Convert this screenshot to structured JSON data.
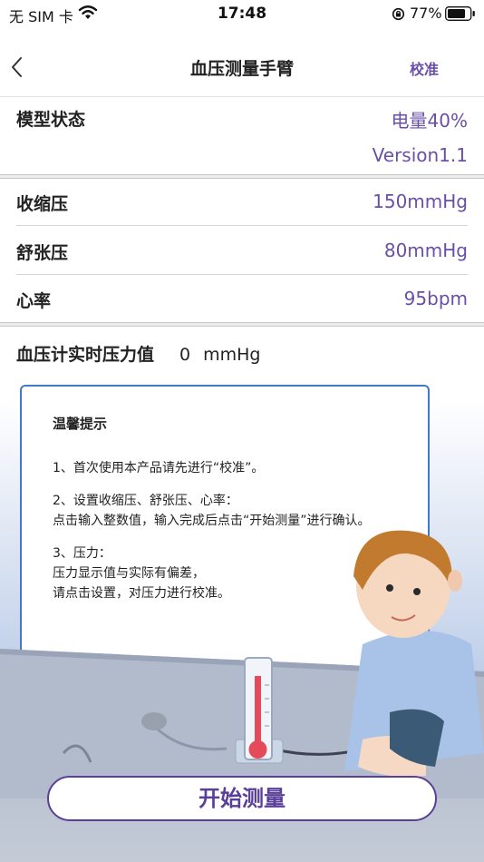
{
  "status_bar": {
    "carrier": "无 SIM 卡",
    "time": "17:48",
    "battery": "77%"
  },
  "nav": {
    "title": "血压测量手臂",
    "action": "校准"
  },
  "model": {
    "label": "模型状态",
    "battery": "电量40%",
    "version": "Version1.1"
  },
  "readings": [
    {
      "label": "收缩压",
      "value": "150mmHg"
    },
    {
      "label": "舒张压",
      "value": "80mmHg"
    },
    {
      "label": "心率",
      "value": "95bpm"
    }
  ],
  "realtime": {
    "label": "血压计实时压力值",
    "value": "0",
    "unit": "mmHg"
  },
  "tips": {
    "title": "温馨提示",
    "tip1": "1、首次使用本产品请先进行“校准”。",
    "tip2_l1": "2、设置收缩压、舒张压、心率：",
    "tip2_l2": "点击输入整数值，输入完成后点击“开始测量”进行确认。",
    "tip3_l1": "3、压力：",
    "tip3_l2": "压力显示值与实际有偏差，",
    "tip3_l3": "请点击设置，对压力进行校准。"
  },
  "start_button": "开始测量",
  "colors": {
    "accent": "#6a4fa8",
    "card_border": "#3f7bc4",
    "button_border": "#5a3f99"
  }
}
